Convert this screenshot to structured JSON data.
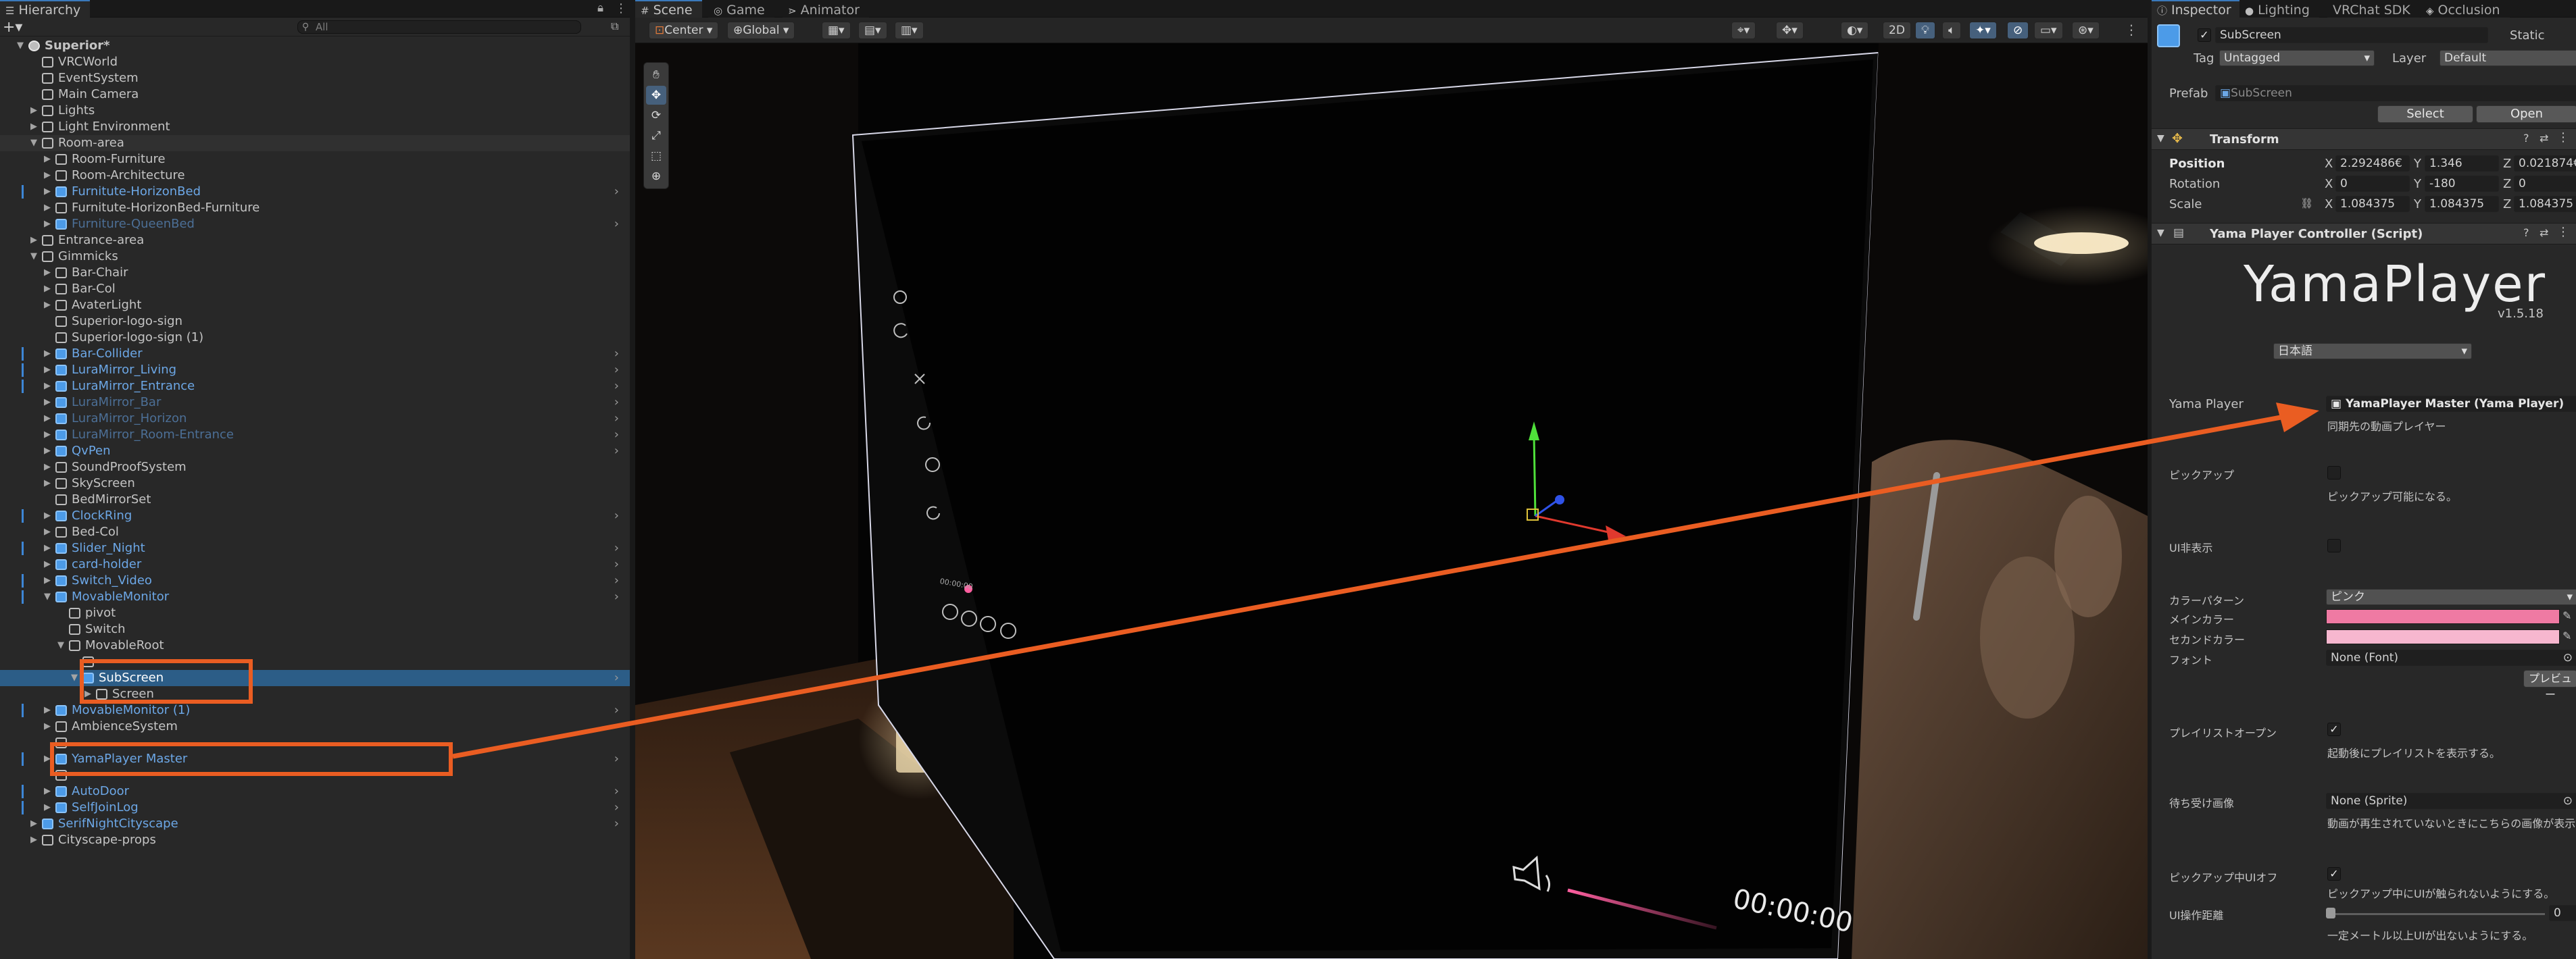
{
  "hierarchy": {
    "tab_label": "Hierarchy",
    "search_placeholder": "All",
    "rows": [
      {
        "label": "Superior*",
        "indent": 0,
        "arrow": "▼",
        "icon": "root",
        "style": ""
      },
      {
        "label": "VRCWorld",
        "indent": 1,
        "arrow": "",
        "icon": "cube",
        "style": ""
      },
      {
        "label": "EventSystem",
        "indent": 1,
        "arrow": "",
        "icon": "cube",
        "style": ""
      },
      {
        "label": "Main Camera",
        "indent": 1,
        "arrow": "",
        "icon": "cube",
        "style": ""
      },
      {
        "label": "Lights",
        "indent": 1,
        "arrow": "▶",
        "icon": "cube",
        "style": ""
      },
      {
        "label": "Light Environment",
        "indent": 1,
        "arrow": "▶",
        "icon": "cube",
        "style": ""
      },
      {
        "label": "Room-area",
        "indent": 1,
        "arrow": "▼",
        "icon": "cube",
        "style": "",
        "hover": true
      },
      {
        "label": "Room-Furniture",
        "indent": 2,
        "arrow": "▶",
        "icon": "cube",
        "style": ""
      },
      {
        "label": "Room-Architecture",
        "indent": 2,
        "arrow": "▶",
        "icon": "cube",
        "style": ""
      },
      {
        "label": "Furnitute-HorizonBed",
        "indent": 2,
        "arrow": "▶",
        "icon": "blue",
        "style": "blue",
        "chev": true,
        "bar": true
      },
      {
        "label": "Furnitute-HorizonBed-Furniture",
        "indent": 2,
        "arrow": "▶",
        "icon": "cube",
        "style": ""
      },
      {
        "label": "Furniture-QueenBed",
        "indent": 2,
        "arrow": "▶",
        "icon": "blue",
        "style": "blue dim",
        "chev": true
      },
      {
        "label": "Entrance-area",
        "indent": 1,
        "arrow": "▶",
        "icon": "cube",
        "style": ""
      },
      {
        "label": "Gimmicks",
        "indent": 1,
        "arrow": "▼",
        "icon": "cube",
        "style": ""
      },
      {
        "label": "Bar-Chair",
        "indent": 2,
        "arrow": "▶",
        "icon": "cube",
        "style": ""
      },
      {
        "label": "Bar-Col",
        "indent": 2,
        "arrow": "▶",
        "icon": "cube",
        "style": ""
      },
      {
        "label": "AvaterLight",
        "indent": 2,
        "arrow": "▶",
        "icon": "cube",
        "style": ""
      },
      {
        "label": "Superior-logo-sign",
        "indent": 2,
        "arrow": "",
        "icon": "cube",
        "style": ""
      },
      {
        "label": "Superior-logo-sign (1)",
        "indent": 2,
        "arrow": "",
        "icon": "cube",
        "style": ""
      },
      {
        "label": "Bar-Collider",
        "indent": 2,
        "arrow": "▶",
        "icon": "blue",
        "style": "blue",
        "chev": true,
        "bar": true
      },
      {
        "label": "LuraMirror_Living",
        "indent": 2,
        "arrow": "▶",
        "icon": "blue",
        "style": "blue",
        "chev": true,
        "bar": true
      },
      {
        "label": "LuraMirror_Entrance",
        "indent": 2,
        "arrow": "▶",
        "icon": "blue",
        "style": "blue",
        "chev": true,
        "bar": true
      },
      {
        "label": "LuraMirror_Bar",
        "indent": 2,
        "arrow": "▶",
        "icon": "blue",
        "style": "blue dim",
        "chev": true
      },
      {
        "label": "LuraMirror_Horizon",
        "indent": 2,
        "arrow": "▶",
        "icon": "blue",
        "style": "blue dim",
        "chev": true
      },
      {
        "label": "LuraMirror_Room-Entrance",
        "indent": 2,
        "arrow": "▶",
        "icon": "blue",
        "style": "blue dim",
        "chev": true
      },
      {
        "label": "QvPen",
        "indent": 2,
        "arrow": "▶",
        "icon": "blue",
        "style": "blue",
        "chev": true
      },
      {
        "label": "SoundProofSystem",
        "indent": 2,
        "arrow": "▶",
        "icon": "cube",
        "style": ""
      },
      {
        "label": "SkyScreen",
        "indent": 2,
        "arrow": "▶",
        "icon": "cube",
        "style": ""
      },
      {
        "label": "BedMirrorSet",
        "indent": 2,
        "arrow": "",
        "icon": "cube",
        "style": ""
      },
      {
        "label": "ClockRing",
        "indent": 2,
        "arrow": "▶",
        "icon": "blue",
        "style": "blue",
        "chev": true,
        "bar": true
      },
      {
        "label": "Bed-Col",
        "indent": 2,
        "arrow": "▶",
        "icon": "cube",
        "style": ""
      },
      {
        "label": "Slider_Night",
        "indent": 2,
        "arrow": "▶",
        "icon": "blue",
        "style": "blue",
        "chev": true,
        "bar": true
      },
      {
        "label": "card-holder",
        "indent": 2,
        "arrow": "▶",
        "icon": "blue",
        "style": "blue",
        "chev": true
      },
      {
        "label": "Switch_Video",
        "indent": 2,
        "arrow": "▶",
        "icon": "blue",
        "style": "blue",
        "chev": true,
        "bar": true
      },
      {
        "label": "MovableMonitor",
        "indent": 2,
        "arrow": "▼",
        "icon": "blue",
        "style": "blue",
        "chev": true,
        "bar": true
      },
      {
        "label": "pivot",
        "indent": 3,
        "arrow": "",
        "icon": "cube",
        "style": ""
      },
      {
        "label": "Switch",
        "indent": 3,
        "arrow": "",
        "icon": "cube",
        "style": ""
      },
      {
        "label": "MovableRoot",
        "indent": 3,
        "arrow": "▼",
        "icon": "cube",
        "style": ""
      },
      {
        "label": "",
        "indent": 4,
        "arrow": "",
        "icon": "cube",
        "style": "dim"
      },
      {
        "label": "SubScreen",
        "indent": 4,
        "arrow": "▼",
        "icon": "blue",
        "style": "sel",
        "chev": true
      },
      {
        "label": "Screen",
        "indent": 5,
        "arrow": "▶",
        "icon": "cube",
        "style": ""
      },
      {
        "label": "MovableMonitor (1)",
        "indent": 2,
        "arrow": "▶",
        "icon": "blue",
        "style": "blue",
        "chev": true,
        "bar": true
      },
      {
        "label": "AmbienceSystem",
        "indent": 2,
        "arrow": "▶",
        "icon": "cube",
        "style": ""
      },
      {
        "label": "",
        "indent": 2,
        "arrow": "",
        "icon": "cube",
        "style": "dim"
      },
      {
        "label": "YamaPlayer Master",
        "indent": 2,
        "arrow": "▶",
        "icon": "blue",
        "style": "blue",
        "chev": true,
        "bar": true
      },
      {
        "label": "",
        "indent": 2,
        "arrow": "",
        "icon": "cube",
        "style": "dim"
      },
      {
        "label": "AutoDoor",
        "indent": 2,
        "arrow": "▶",
        "icon": "blue",
        "style": "blue",
        "chev": true,
        "bar": true
      },
      {
        "label": "SelfJoinLog",
        "indent": 2,
        "arrow": "▶",
        "icon": "blue",
        "style": "blue",
        "chev": true,
        "bar": true
      },
      {
        "label": "SerifNightCityscape",
        "indent": 1,
        "arrow": "▶",
        "icon": "blue",
        "style": "blue",
        "chev": true
      },
      {
        "label": "Cityscape-props",
        "indent": 1,
        "arrow": "▶",
        "icon": "cube",
        "style": ""
      }
    ]
  },
  "scene": {
    "tabs": [
      "Scene",
      "Game",
      "Animator"
    ],
    "toolbar": {
      "pivot": "Center",
      "space": "Global",
      "mode_2d": "2D"
    },
    "overlay_time": "00:00:00",
    "small_time": "00:00:00"
  },
  "inspector": {
    "tabs": [
      "Inspector",
      "Lighting",
      "VRChat SDK",
      "Occlusion"
    ],
    "object_name": "SubScreen",
    "static_label": "Static",
    "tag_label": "Tag",
    "tag_value": "Untagged",
    "layer_label": "Layer",
    "layer_value": "Default",
    "prefab_label": "Prefab",
    "prefab_value": "SubScreen",
    "select_button": "Select",
    "open_button": "Open",
    "transform": {
      "title": "Transform",
      "position_label": "Position",
      "rotation_label": "Rotation",
      "scale_label": "Scale",
      "position": {
        "x": "2.292486€",
        "y": "1.346",
        "z": "0.021874€"
      },
      "rotation": {
        "x": "0",
        "y": "-180",
        "z": "0"
      },
      "scale": {
        "x": "1.084375",
        "y": "1.084375",
        "z": "1.084375"
      }
    },
    "script": {
      "title": "Yama Player Controller (Script)",
      "logo": "YamaPlayer",
      "version": "v1.5.18",
      "language": "日本語",
      "yama_player_label": "Yama Player",
      "yama_player_value": "YamaPlayer Master (Yama Player)",
      "yama_player_help": "同期先の動画プレイヤー",
      "pickup_label": "ピックアップ",
      "pickup_help": "ピックアップ可能になる。",
      "ui_hide_label": "UI非表示",
      "color_pattern_label": "カラーパターン",
      "color_pattern_value": "ピンク",
      "main_color_label": "メインカラー",
      "second_color_label": "セカンドカラー",
      "font_label": "フォント",
      "font_value": "None (Font)",
      "preview_button": "プレビュー",
      "playlist_open_label": "プレイリストオープン",
      "playlist_open_help": "起動後にプレイリストを表示する。",
      "idle_image_label": "待ち受け画像",
      "idle_image_value": "None (Sprite)",
      "idle_image_help": "動画が再生されていないときにこちらの画像が表示され",
      "pickup_ui_off_label": "ピックアップ中UIオフ",
      "pickup_ui_off_help": "ピックアップ中にUIが触られないようにする。",
      "ui_distance_label": "UI操作距離",
      "ui_distance_value": "0",
      "ui_distance_help": "一定メートル以上UIが出ないようにする。",
      "main_color": "#ef7aa3",
      "second_color": "#f7b7cf"
    }
  },
  "colors": {
    "accent": "#ea5d22",
    "selection": "#2c5d87",
    "prefab_blue": "#6ca7e6"
  }
}
